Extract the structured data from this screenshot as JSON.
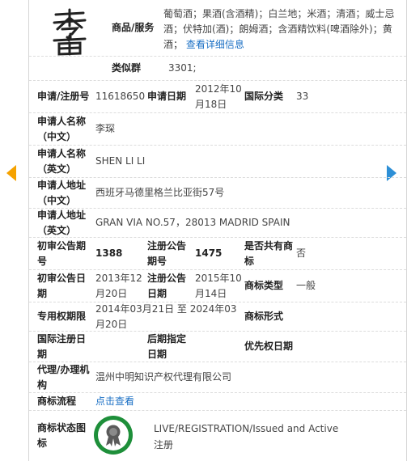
{
  "goods": {
    "label": "商品/服务",
    "text": "葡萄酒；果酒(含酒精)；白兰地；米酒；清酒；威士忌酒；伏特加(酒)；朗姆酒；含酒精饮料(啤酒除外)；黄酒；",
    "detail_link": "查看详细信息"
  },
  "similar_group": {
    "label": "类似群",
    "value": "3301;"
  },
  "reg_no": {
    "label": "申请/注册号",
    "value": "11618650"
  },
  "apply_date": {
    "label": "申请日期",
    "value": "2012年10月18日"
  },
  "intl_class": {
    "label": "国际分类",
    "value": "33"
  },
  "applicant_cn": {
    "label": "申请人名称（中文）",
    "value": "李琛"
  },
  "applicant_en": {
    "label": "申请人名称（英文）",
    "value": "SHEN LI LI"
  },
  "address_cn": {
    "label": "申请人地址（中文）",
    "value": "西班牙马德里格兰比亚街57号"
  },
  "address_en": {
    "label": "申请人地址（英文）",
    "value": "GRAN VIA NO.57，28013 MADRID SPAIN"
  },
  "prelim_issue": {
    "label": "初审公告期号",
    "value": "1388"
  },
  "reg_issue": {
    "label": "注册公告期号",
    "value": "1475"
  },
  "shared": {
    "label": "是否共有商标",
    "value": "否"
  },
  "prelim_date": {
    "label": "初审公告日期",
    "value": "2013年12月20日"
  },
  "reg_date": {
    "label": "注册公告日期",
    "value": "2015年10月14日"
  },
  "tm_type": {
    "label": "商标类型",
    "value": "一般"
  },
  "exclusive_period": {
    "label": "专用权期限",
    "value": "2014年03月21日 至 2024年03月20日"
  },
  "tm_form": {
    "label": "商标形式",
    "value": ""
  },
  "intl_reg_date": {
    "label": "国际注册日期",
    "value": ""
  },
  "later_date": {
    "label": "后期指定日期",
    "value": ""
  },
  "priority_date": {
    "label": "优先权日期",
    "value": ""
  },
  "agent": {
    "label": "代理/办理机构",
    "value": "温州中明知识产权代理有限公司"
  },
  "process": {
    "label": "商标流程",
    "link": "点击查看"
  },
  "status": {
    "label": "商标状态图标",
    "line1": "LIVE/REGISTRATION/Issued and Active",
    "line2": "注册"
  },
  "colors": {
    "accent_link": "#1a6fc4",
    "badge_green": "#1e8f3a",
    "arrow_left": "#f5a200",
    "arrow_right": "#2d8fd6"
  },
  "icons": {
    "prev": "arrow-left-icon",
    "next": "arrow-right-icon",
    "status": "registered-ribbon-icon"
  }
}
